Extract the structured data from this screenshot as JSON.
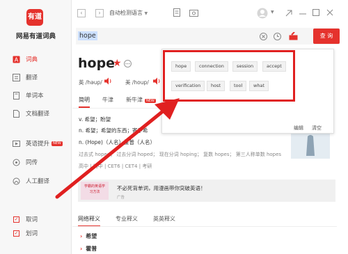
{
  "sidebar": {
    "logo_text": "有道",
    "app_name": "网易有道词典",
    "items": [
      {
        "label": "词典",
        "icon": "dictionary-icon",
        "active": true
      },
      {
        "label": "翻译",
        "icon": "translate-icon"
      },
      {
        "label": "单词本",
        "icon": "wordbook-icon"
      },
      {
        "label": "文档翻译",
        "icon": "document-translate-icon"
      },
      {
        "label": "英语提升",
        "icon": "english-improve-icon",
        "badge": "NEW"
      },
      {
        "label": "同传",
        "icon": "simultaneous-icon"
      },
      {
        "label": "人工翻译",
        "icon": "human-translate-icon"
      }
    ],
    "checks": [
      {
        "label": "取词"
      },
      {
        "label": "划词"
      }
    ]
  },
  "topbar": {
    "language_select": "自动检测语言"
  },
  "search": {
    "query": "hope",
    "button": "查 询"
  },
  "entry": {
    "word": "hope",
    "uk_label": "英 /həup/",
    "us_label": "美 /houp/",
    "tabs": [
      "简明",
      "牛津",
      "新牛津"
    ],
    "tab_badge": "NEW",
    "defs": [
      "v. 希望；盼望",
      "n. 希望；希望的东西；寄予希",
      "n. (Hope)（人名）霍普（人名）"
    ],
    "forms": "过去式 hoped； 过去分词 hoped； 现在分词 hoping； 复数 hopes； 第三人称单数 hopes",
    "levels": "高中 | 初中 | CET6 | CET4 | 考研"
  },
  "ad": {
    "thumb_text": "学霸的英语学习方法",
    "text": "不必死背单词，用漫画带你突破英语！",
    "tag": "广告"
  },
  "sub_tabs": [
    "网络释义",
    "专业释义",
    "英英释义"
  ],
  "web_items": [
    "希望",
    "霍普"
  ],
  "popup": {
    "chips_row1": [
      "hope",
      "connection",
      "session",
      "accept"
    ],
    "chips_row2": [
      "verification",
      "host",
      "tool",
      "what"
    ],
    "edit": "编辑",
    "clear": "清空"
  },
  "colors": {
    "accent": "#e5322d",
    "highlight_box": "#e02020"
  }
}
